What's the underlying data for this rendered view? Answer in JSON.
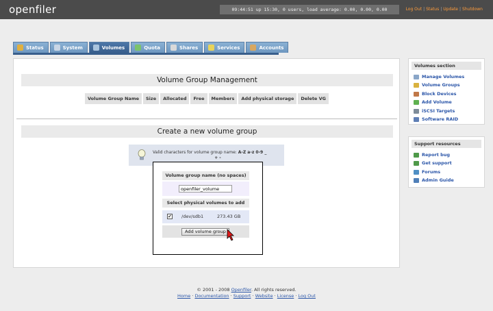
{
  "app": {
    "logo": "openfiler"
  },
  "header": {
    "status_text": "09:44:51 up 15:30, 0 users, load average: 0.00, 0.00, 0.00",
    "links": [
      "Log Out",
      "Status",
      "Update",
      "Shutdown"
    ]
  },
  "tabs": [
    {
      "label": "Status",
      "icon": "status-icon",
      "color": "#e0b040"
    },
    {
      "label": "System",
      "icon": "system-icon",
      "color": "#c9d6e6"
    },
    {
      "label": "Volumes",
      "icon": "volumes-icon",
      "color": "#a9c4de",
      "active": true
    },
    {
      "label": "Quota",
      "icon": "quota-icon",
      "color": "#7cc36b"
    },
    {
      "label": "Shares",
      "icon": "shares-icon",
      "color": "#d9d9d9"
    },
    {
      "label": "Services",
      "icon": "services-icon",
      "color": "#e8d35a"
    },
    {
      "label": "Accounts",
      "icon": "accounts-icon",
      "color": "#d8a760"
    }
  ],
  "vgm": {
    "title": "Volume Group Management",
    "columns": [
      "Volume Group Name",
      "Size",
      "Allocated",
      "Free",
      "Members",
      "Add physical storage",
      "Delete VG"
    ]
  },
  "create": {
    "title": "Create a new volume group",
    "hint_prefix": "Valid characters for volume group name: ",
    "hint_chars": "A-Z a-z 0-9 _",
    "hint_chars2": "+ -",
    "name_label": "Volume group name (no spaces)",
    "name_value": "openfiler_volume",
    "pv_label": "Select physical volumes to add",
    "pv": {
      "checked": true,
      "check_glyph": "✔",
      "device": "/dev/sdb1",
      "size": "273.43 GB"
    },
    "button": "Add volume group"
  },
  "sidebar": {
    "volumes_title": "Volumes section",
    "volumes_items": [
      {
        "label": "Manage Volumes",
        "icon": "manage-volumes-icon",
        "color": "#8aa6c8"
      },
      {
        "label": "Volume Groups",
        "icon": "volume-groups-icon",
        "color": "#d9b23f"
      },
      {
        "label": "Block Devices",
        "icon": "block-devices-icon",
        "color": "#c07848"
      },
      {
        "label": "Add Volume",
        "icon": "add-volume-icon",
        "color": "#5fb14f"
      },
      {
        "label": "iSCSI Targets",
        "icon": "iscsi-targets-icon",
        "color": "#7e8c99"
      },
      {
        "label": "Software RAID",
        "icon": "software-raid-icon",
        "color": "#5f7fb5"
      }
    ],
    "support_title": "Support resources",
    "support_items": [
      {
        "label": "Report bug",
        "icon": "report-bug-icon",
        "color": "#4f9a4a"
      },
      {
        "label": "Get support",
        "icon": "get-support-icon",
        "color": "#4f9a4a"
      },
      {
        "label": "Forums",
        "icon": "forums-icon",
        "color": "#4f8fc4"
      },
      {
        "label": "Admin Guide",
        "icon": "admin-guide-icon",
        "color": "#4f7fb8"
      }
    ]
  },
  "footer": {
    "copyright_prefix": "© 2001 - 2008 ",
    "copyright_link": "Openfiler",
    "copyright_suffix": ". All rights reserved.",
    "links": [
      "Home",
      "Documentation",
      "Support",
      "Website",
      "License",
      "Log Out"
    ],
    "separator": " · "
  }
}
